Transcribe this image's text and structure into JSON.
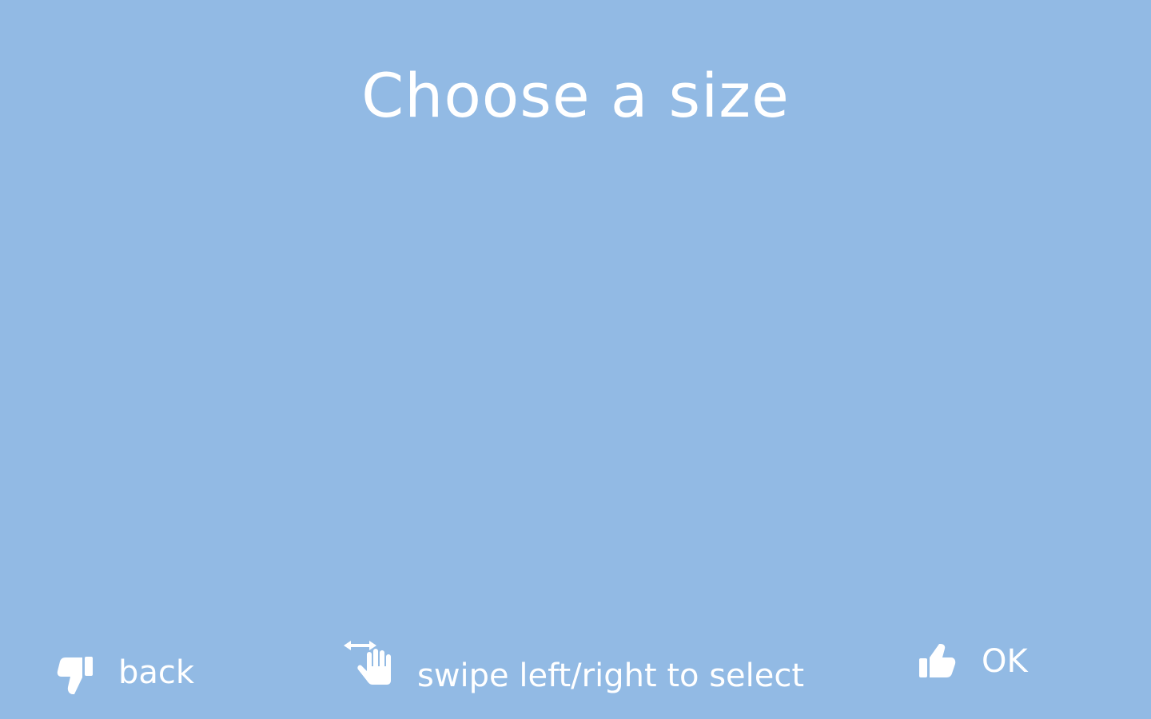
{
  "screen": {
    "background_color": "#92bae4",
    "text_color": "#ffffff",
    "title": "Choose a size"
  },
  "footer": {
    "back": {
      "label": "back",
      "icon": "thumbs-down-icon"
    },
    "hint": {
      "label": "swipe left/right to select",
      "icon": "swipe-hand-icon"
    },
    "ok": {
      "label": "OK",
      "icon": "thumbs-up-icon"
    }
  }
}
